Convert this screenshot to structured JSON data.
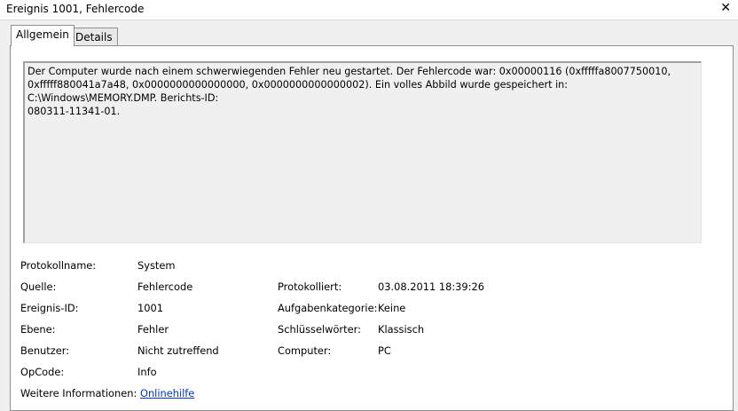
{
  "window": {
    "title": "Ereignis 1001, Fehlercode",
    "close_glyph": "✕"
  },
  "tabs": [
    {
      "label": "Allgemein",
      "active": true
    },
    {
      "label": "Details",
      "active": false
    }
  ],
  "message": "Der Computer wurde nach einem schwerwiegenden Fehler neu gestartet. Der Fehlercode war: 0x00000116 (0xfffffa8007750010,\n0xfffff880041a7a48, 0x0000000000000000, 0x0000000000000002). Ein volles Abbild wurde gespeichert in: C:\\Windows\\MEMORY.DMP. Berichts-ID:\n080311-11341-01.",
  "fields": {
    "protokollname": {
      "label": "Protokollname:",
      "value": "System"
    },
    "quelle": {
      "label": "Quelle:",
      "value": "Fehlercode"
    },
    "protokolliert": {
      "label": "Protokolliert:",
      "value": "03.08.2011 18:39:26"
    },
    "ereignis_id": {
      "label": "Ereignis-ID:",
      "value": "1001"
    },
    "aufgabenkategorie": {
      "label": "Aufgabenkategorie:",
      "value": "Keine"
    },
    "ebene": {
      "label": "Ebene:",
      "value": "Fehler"
    },
    "schluesselwoerter": {
      "label": "Schlüsselwörter:",
      "value": "Klassisch"
    },
    "benutzer": {
      "label": "Benutzer:",
      "value": "Nicht zutreffend"
    },
    "computer": {
      "label": "Computer:",
      "value": "PC"
    },
    "opcode": {
      "label": "OpCode:",
      "value": "Info"
    },
    "weitere_informationen": {
      "label": "Weitere Informationen:",
      "value": "Onlinehilfe"
    }
  },
  "colors": {
    "link": "#0033cc",
    "panel_bg": "#ffffff",
    "window_bg": "#f0f0f0"
  }
}
